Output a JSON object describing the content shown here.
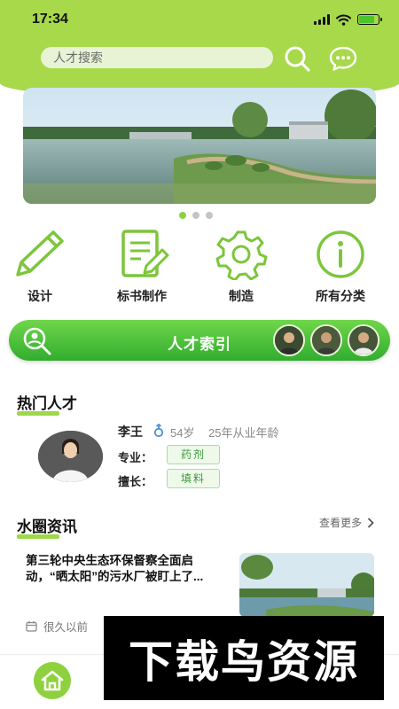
{
  "status_bar": {
    "time": "17:34",
    "battery_level": 0.8
  },
  "search": {
    "placeholder": "人才搜索"
  },
  "icons": {
    "search": "search-icon",
    "chat": "chat-bubble-icon",
    "home": "home-icon"
  },
  "banner": {
    "slides": 3,
    "active_index": 0
  },
  "categories": [
    {
      "label": "设计",
      "icon": "pencil-icon"
    },
    {
      "label": "标书制作",
      "icon": "document-edit-icon"
    },
    {
      "label": "制造",
      "icon": "gear-icon"
    },
    {
      "label": "所有分类",
      "icon": "info-icon"
    }
  ],
  "talent_index": {
    "label": "人才索引"
  },
  "hot_talent": {
    "title": "热门人才",
    "person": {
      "name": "李王",
      "age": "54岁",
      "years": "25年从业年龄",
      "major_label": "专业：",
      "major": "药剂",
      "skill_label": "擅长：",
      "skill": "填料"
    }
  },
  "news": {
    "title": "水圈资讯",
    "more": "查看更多",
    "items": [
      {
        "title": "第三轮中央生态环保督察全面启动，“晒太阳”的污水厂被盯上了...",
        "time": "很久以前"
      }
    ]
  },
  "watermark": {
    "text": "下载鸟资源"
  },
  "colors": {
    "accent": "#a7d94a",
    "talent_bar": "#31ad2e",
    "tag_text": "#3a9a3a"
  }
}
